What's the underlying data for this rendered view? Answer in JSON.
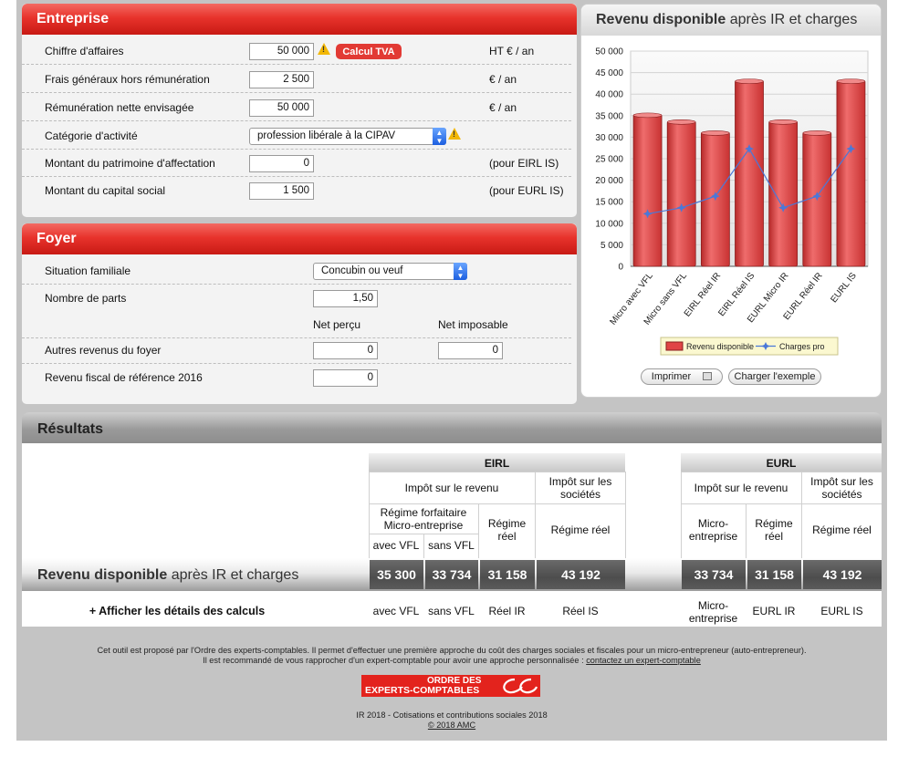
{
  "entreprise": {
    "title": "Entreprise",
    "rows": [
      {
        "label": "Chiffre d'affaires",
        "value": "50 000",
        "unit": "HT € / an"
      },
      {
        "label": "Frais généraux hors rémunération",
        "value": "2 500",
        "unit": "€ / an"
      },
      {
        "label": "Rémunération nette envisagée",
        "value": "50 000",
        "unit": "€ / an"
      },
      {
        "label": "Catégorie d'activité",
        "value": "profession libérale à la CIPAV",
        "unit": ""
      },
      {
        "label": "Montant du patrimoine d'affectation",
        "value": "0",
        "unit": "(pour EIRL IS)"
      },
      {
        "label": "Montant du capital social",
        "value": "1 500",
        "unit": "(pour EURL IS)"
      }
    ],
    "calcul_tva": "Calcul TVA",
    "warn_glyph": "!"
  },
  "foyer": {
    "title": "Foyer",
    "situation_label": "Situation familiale",
    "situation_value": "Concubin ou veuf",
    "parts_label": "Nombre de parts",
    "parts_value": "1,50",
    "net_percu": "Net perçu",
    "net_imposable": "Net imposable",
    "autres_label": "Autres revenus du foyer",
    "autres_percu": "0",
    "autres_imposable": "0",
    "rfr_label": "Revenu fiscal de référence 2016",
    "rfr_value": "0"
  },
  "chart_panel": {
    "title_bold": "Revenu disponible",
    "title_rest": " après IR et charges",
    "print_button": "Imprimer",
    "example_button": "Charger l'exemple"
  },
  "chart_data": {
    "type": "bar",
    "categories": [
      "Micro avec VFL",
      "Micro sans VFL",
      "EIRL Réel IR",
      "EIRL Réel IS",
      "EURL Micro IR",
      "EURL Réel IR",
      "EURL IS"
    ],
    "series": [
      {
        "name": "Revenu disponible",
        "type": "bar",
        "color": "#e04545",
        "values": [
          35300,
          33734,
          31158,
          43192,
          33734,
          31158,
          43192
        ]
      },
      {
        "name": "Charges pro",
        "type": "line",
        "color": "#4a78d8",
        "values": [
          12200,
          13600,
          16300,
          27300,
          13600,
          16300,
          27300
        ]
      }
    ],
    "yticks": [
      "50 000",
      "45 000",
      "40 000",
      "35 000",
      "30 000",
      "25 000",
      "20 000",
      "15 000",
      "10 000",
      "5 000",
      "0"
    ],
    "ylim": [
      0,
      50000
    ],
    "grid": true,
    "legend_position": "bottom"
  },
  "results": {
    "title": "Résultats",
    "eirl": "EIRL",
    "eurl": "EURL",
    "ir": "Impôt sur le revenu",
    "is": "Impôt sur les sociétés",
    "regime_forfaitaire": "Régime forfaitaire Micro-entreprise",
    "regime_reel": "Régime réel",
    "micro_entreprise": "Micro-entreprise",
    "avec_vfl": "avec VFL",
    "sans_vfl": "sans VFL",
    "band_bold": "Revenu disponible",
    "band_rest": " après IR et charges",
    "values": [
      "35 300",
      "33 734",
      "31 158",
      "43 192",
      "33 734",
      "31 158",
      "43 192"
    ],
    "details_link": "+ Afficher les détails des calculs",
    "bottom_labels": [
      "avec VFL",
      "sans VFL",
      "Réel IR",
      "Réel IS",
      "Micro-entreprise",
      "EURL IR",
      "EURL IS"
    ]
  },
  "footer": {
    "line1": "Cet outil est proposé par l'Ordre des experts-comptables. Il permet d'effectuer une première approche du coût des charges sociales et fiscales pour un micro-entrepreneur (auto-entrepreneur).",
    "line2_pre": "Il est recommandé de vous rapprocher d'un expert-comptable pour avoir une approche personnalisée : ",
    "line2_link": "contactez un expert-comptable",
    "logo_line1": "ORDRE DES",
    "logo_line2": "EXPERTS-COMPTABLES",
    "ir_line": "IR 2018 - Cotisations et contributions sociales 2018",
    "copyright": "© 2018 AMC"
  }
}
